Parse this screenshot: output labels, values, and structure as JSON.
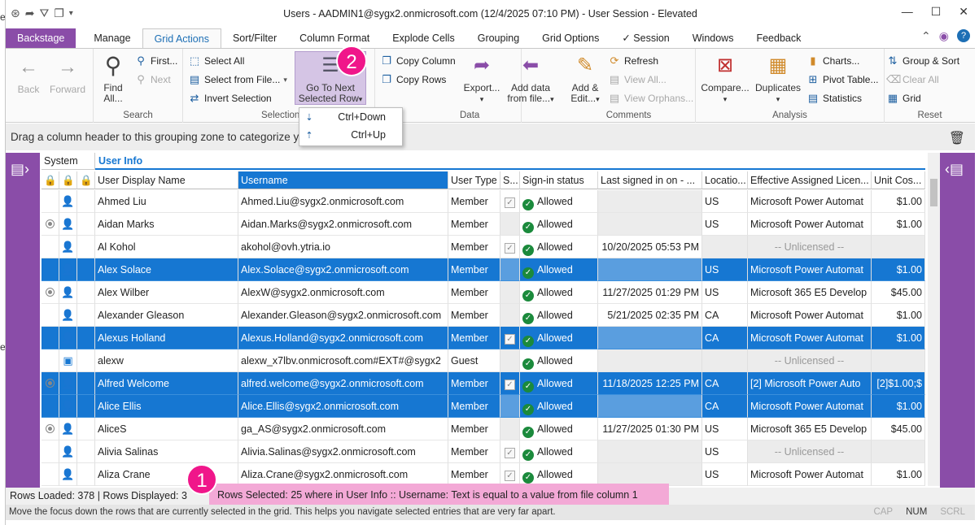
{
  "window": {
    "title": "Users - AADMIN1@sygx2.onmicrosoft.com (12/4/2025 07:10 PM) - User Session - Elevated"
  },
  "tabs": [
    "Backstage",
    "Manage",
    "Grid Actions",
    "Sort/Filter",
    "Column Format",
    "Explode Cells",
    "Grouping",
    "Grid Options",
    "✓ Session",
    "Windows",
    "Feedback"
  ],
  "ribbon": {
    "back": "Back",
    "forward": "Forward",
    "find": "Find",
    "find2": "All...",
    "first": "First...",
    "next": "Next",
    "search_group": "Search",
    "select_all": "Select All",
    "select_from_file": "Select from File...",
    "invert_selection": "Invert Selection",
    "selection_group": "Selection",
    "goto_next1": "Go To Next",
    "goto_next2": "Selected Row",
    "copy_column": "Copy Column",
    "copy_rows": "Copy Rows",
    "data_group": "Data",
    "export": "Export...",
    "add_data1": "Add data",
    "add_data2": "from file...",
    "add_edit1": "Add &",
    "add_edit2": "Edit...",
    "refresh": "Refresh",
    "view_all": "View All...",
    "view_orphans": "View Orphans...",
    "comments_group": "Comments",
    "compare": "Compare...",
    "duplicates": "Duplicates",
    "charts": "Charts...",
    "pivot": "Pivot Table...",
    "statistics": "Statistics",
    "analysis_group": "Analysis",
    "group_sort": "Group & Sort",
    "clear_all": "Clear All",
    "grid": "Grid",
    "reset_group": "Reset"
  },
  "popup": [
    {
      "key": "Ctrl+Down"
    },
    {
      "key": "Ctrl+Up"
    }
  ],
  "badges": {
    "one": "1",
    "two": "2"
  },
  "groupzone": "Drag a column header to this grouping zone to categorize y",
  "bands": {
    "system": "System",
    "user_info": "User Info"
  },
  "headers": [
    "User Display Name",
    "Username",
    "User Type",
    "S...",
    "Sign-in status",
    "Last signed in on - ...",
    "Locatio...",
    "Effective Assigned Licen...",
    "Unit Cos..."
  ],
  "rows": [
    {
      "name": "Ahmed Liu",
      "user": "Ahmed.Liu@sygx2.onmicrosoft.com",
      "type": "Member",
      "chk": true,
      "signin": "Allowed",
      "last": "",
      "loc": "US",
      "lic": "Microsoft Power Automat",
      "cost": "$1.00"
    },
    {
      "name": "Aidan Marks",
      "user": "Aidan.Marks@sygx2.onmicrosoft.com",
      "type": "Member",
      "chk": false,
      "signin": "Allowed",
      "last": "",
      "loc": "US",
      "lic": "Microsoft Power Automat",
      "cost": "$1.00"
    },
    {
      "name": "Al Kohol",
      "user": "akohol@ovh.ytria.io",
      "type": "Member",
      "chk": true,
      "signin": "Allowed",
      "last": "10/20/2025 05:53 PM",
      "loc": "",
      "lic": "-- Unlicensed --",
      "cost": ""
    },
    {
      "name": "Alex Solace",
      "user": "Alex.Solace@sygx2.onmicrosoft.com",
      "type": "Member",
      "chk": false,
      "signin": "Allowed",
      "last": "",
      "loc": "US",
      "lic": "Microsoft Power Automat",
      "cost": "$1.00"
    },
    {
      "name": "Alex Wilber",
      "user": "AlexW@sygx2.onmicrosoft.com",
      "type": "Member",
      "chk": false,
      "signin": "Allowed",
      "last": "11/27/2025 01:29 PM",
      "loc": "US",
      "lic": "Microsoft 365 E5 Develop",
      "cost": "$45.00"
    },
    {
      "name": "Alexander Gleason",
      "user": "Alexander.Gleason@sygx2.onmicrosoft.com",
      "type": "Member",
      "chk": false,
      "signin": "Allowed",
      "last": "5/21/2025 02:35 PM",
      "loc": "CA",
      "lic": "Microsoft Power Automat",
      "cost": "$1.00"
    },
    {
      "name": "Alexus Holland",
      "user": "Alexus.Holland@sygx2.onmicrosoft.com",
      "type": "Member",
      "chk": true,
      "signin": "Allowed",
      "last": "",
      "loc": "CA",
      "lic": "Microsoft Power Automat",
      "cost": "$1.00"
    },
    {
      "name": "alexw",
      "user": "alexw_x7lbv.onmicrosoft.com#EXT#@sygx2",
      "type": "Guest",
      "chk": false,
      "signin": "Allowed",
      "last": "",
      "loc": "",
      "lic": "-- Unlicensed --",
      "cost": ""
    },
    {
      "name": "Alfred Welcome",
      "user": "alfred.welcome@sygx2.onmicrosoft.com",
      "type": "Member",
      "chk": true,
      "signin": "Allowed",
      "last": "11/18/2025 12:25 PM",
      "loc": "CA",
      "lic": "[2] Microsoft Power Auto",
      "cost": "[2]$1.00;$"
    },
    {
      "name": "Alice Ellis",
      "user": "Alice.Ellis@sygx2.onmicrosoft.com",
      "type": "Member",
      "chk": false,
      "signin": "Allowed",
      "last": "",
      "loc": "CA",
      "lic": "Microsoft Power Automat",
      "cost": "$1.00"
    },
    {
      "name": "AliceS",
      "user": "ga_AS@sygx2.onmicrosoft.com",
      "type": "Member",
      "chk": false,
      "signin": "Allowed",
      "last": "11/27/2025 01:30 PM",
      "loc": "US",
      "lic": "Microsoft 365 E5 Develop",
      "cost": "$45.00"
    },
    {
      "name": "Alivia Salinas",
      "user": "Alivia.Salinas@sygx2.onmicrosoft.com",
      "type": "Member",
      "chk": true,
      "signin": "Allowed",
      "last": "",
      "loc": "US",
      "lic": "-- Unlicensed --",
      "cost": ""
    },
    {
      "name": "Aliza Crane",
      "user": "Aliza.Crane@sygx2.onmicrosoft.com",
      "type": "Member",
      "chk": true,
      "signin": "Allowed",
      "last": "",
      "loc": "US",
      "lic": "Microsoft Power Automat",
      "cost": "$1.00"
    }
  ],
  "status": {
    "rows_loaded": "Rows Loaded: 378 | Rows Displayed: 3",
    "rows_selected": "Rows Selected: 25 where in User Info :: Username: Text is equal to a value from file column 1",
    "hint": "Move the focus down the rows that are currently selected in the grid. This helps you navigate selected entries that are very far apart.",
    "cap": "CAP",
    "num": "NUM",
    "scrl": "SCRL"
  },
  "colors": {
    "accent": "#8a4da8",
    "selection": "#1677d2",
    "badge": "#f0168a",
    "highlight": "#f3a9d6"
  }
}
